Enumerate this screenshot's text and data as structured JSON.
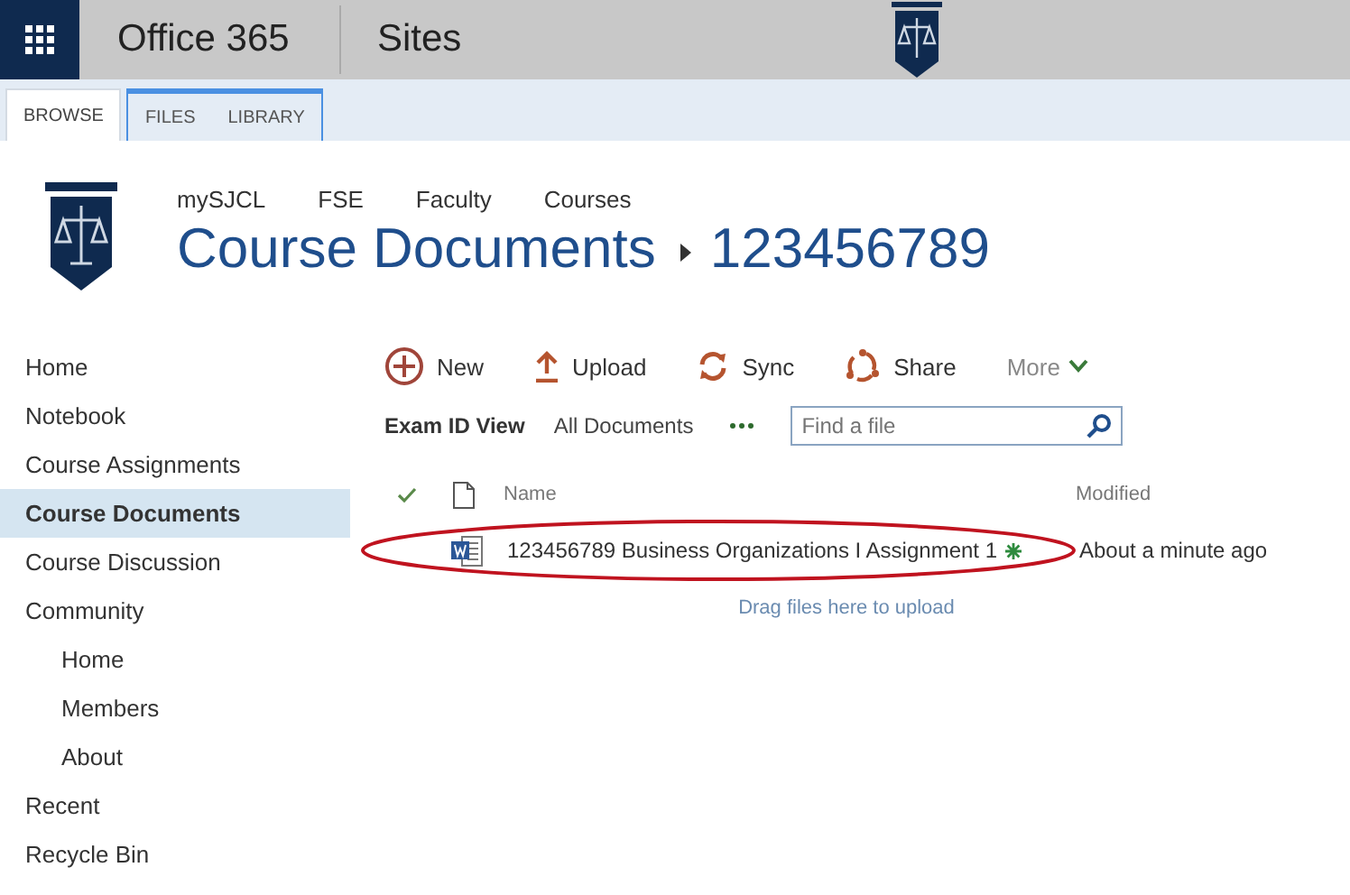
{
  "top_bar": {
    "app_name": "Office 365",
    "section": "Sites"
  },
  "ribbon_tabs": [
    {
      "label": "BROWSE",
      "selected": true
    },
    {
      "label": "FILES",
      "selected": false
    },
    {
      "label": "LIBRARY",
      "selected": false
    }
  ],
  "breadcrumb": [
    "mySJCL",
    "FSE",
    "Faculty",
    "Courses"
  ],
  "title": {
    "library": "Course Documents",
    "folder": "123456789"
  },
  "sidebar": {
    "items": [
      {
        "label": "Home",
        "selected": false
      },
      {
        "label": "Notebook",
        "selected": false
      },
      {
        "label": "Course Assignments",
        "selected": false
      },
      {
        "label": "Course Documents",
        "selected": true
      },
      {
        "label": "Course Discussion",
        "selected": false
      },
      {
        "label": "Community",
        "selected": false,
        "children": [
          {
            "label": "Home",
            "selected": false
          },
          {
            "label": "Members",
            "selected": false
          },
          {
            "label": "About",
            "selected": false
          }
        ]
      },
      {
        "label": "Recent",
        "selected": false
      },
      {
        "label": "Recycle Bin",
        "selected": false
      }
    ]
  },
  "commands": [
    {
      "kind": "new",
      "label": "New"
    },
    {
      "kind": "upload",
      "label": "Upload"
    },
    {
      "kind": "sync",
      "label": "Sync"
    },
    {
      "kind": "share",
      "label": "Share"
    },
    {
      "kind": "more",
      "label": "More"
    }
  ],
  "views": [
    {
      "label": "Exam ID View",
      "selected": true
    },
    {
      "label": "All Documents",
      "selected": false
    }
  ],
  "search": {
    "placeholder": "Find a file"
  },
  "table": {
    "columns": [
      "Name",
      "Modified"
    ],
    "rows": [
      {
        "name": "123456789 Business Organizations I Assignment 1",
        "modified": "About a minute ago",
        "new": true,
        "highlighted": true
      }
    ]
  },
  "drop_hint": "Drag files here to upload"
}
